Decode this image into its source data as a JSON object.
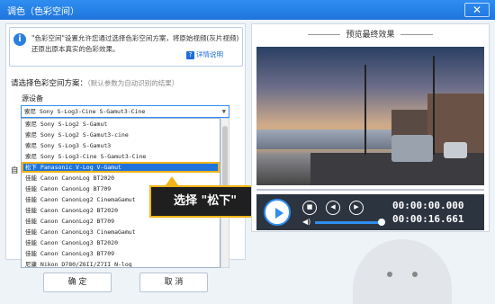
{
  "window": {
    "title": "调色（色彩空间）",
    "close_label": "✕"
  },
  "info": {
    "icon": "i",
    "text": "\"色彩空间\"设置允许您通过选择色彩空间方案，将原始视频(灰片视频)还原出原本真实的色彩效果。",
    "help_label": "详情说明"
  },
  "scheme": {
    "label": "请选择色彩空间方案：",
    "hint": "（默认参数为自动识别的结果）"
  },
  "device": {
    "label": "源设备"
  },
  "auto_label": "自",
  "select": {
    "value": "索尼 Sony S-Log3-Cine S-Gamut3-Cine"
  },
  "dropdown_items": [
    "索尼 Sony S-Log2 S-Gamut",
    "索尼 Sony S-Log2 S-Gamut3-cine",
    "索尼 Sony S-Log3 S-Gamut3",
    "索尼 Sony S-Log3-Cine S-Gamut3-Cine",
    "松下 Panasonic V-Log V-Gamut",
    "佳能 Canon CanonLog BT2020",
    "佳能 Canon CanonLog BT709",
    "佳能 Canon CanonLog2 CinemaGamut",
    "佳能 Canon CanonLog2 BT2020",
    "佳能 Canon CanonLog2 BT709",
    "佳能 Canon CanonLog3 CinemaGamut",
    "佳能 Canon CanonLog3 BT2020",
    "佳能 Canon CanonLog3 BT709",
    "尼康 Nikon D780/Z6II/Z7II N-log"
  ],
  "selected_index": 4,
  "callout": {
    "text": "选择 \"松下\""
  },
  "buttons": {
    "ok": "确 定",
    "cancel": "取 消"
  },
  "preview": {
    "title": "预览最终效果"
  },
  "player": {
    "current_time": "00:00:00.000",
    "total_time": "00:00:16.661",
    "volume_level": 1.0
  }
}
